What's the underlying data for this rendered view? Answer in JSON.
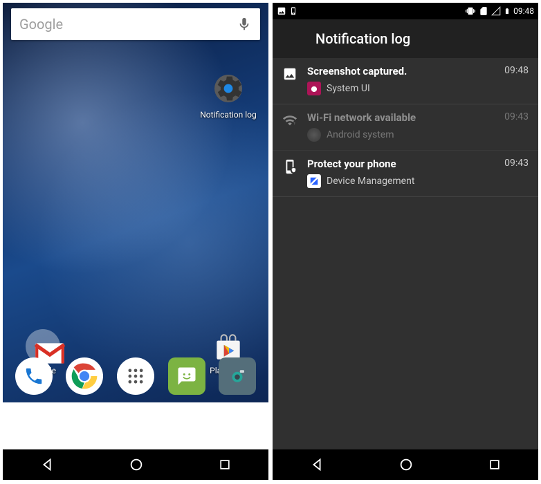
{
  "status": {
    "time": "09:48"
  },
  "home": {
    "search_placeholder": "Google",
    "widget_label": "Notification log",
    "google_folder_label": "Google",
    "playstore_label": "Play Store"
  },
  "nlog": {
    "title": "Notification log",
    "entries": [
      {
        "title": "Screenshot captured.",
        "source": "System UI",
        "time": "09:48",
        "dim": false,
        "icon": "picture"
      },
      {
        "title": "Wi-Fi network available",
        "source": "Android system",
        "time": "09:43",
        "dim": true,
        "icon": "wifi"
      },
      {
        "title": "Protect your phone",
        "source": "Device Management",
        "time": "09:43",
        "dim": false,
        "icon": "shield-phone"
      }
    ]
  }
}
